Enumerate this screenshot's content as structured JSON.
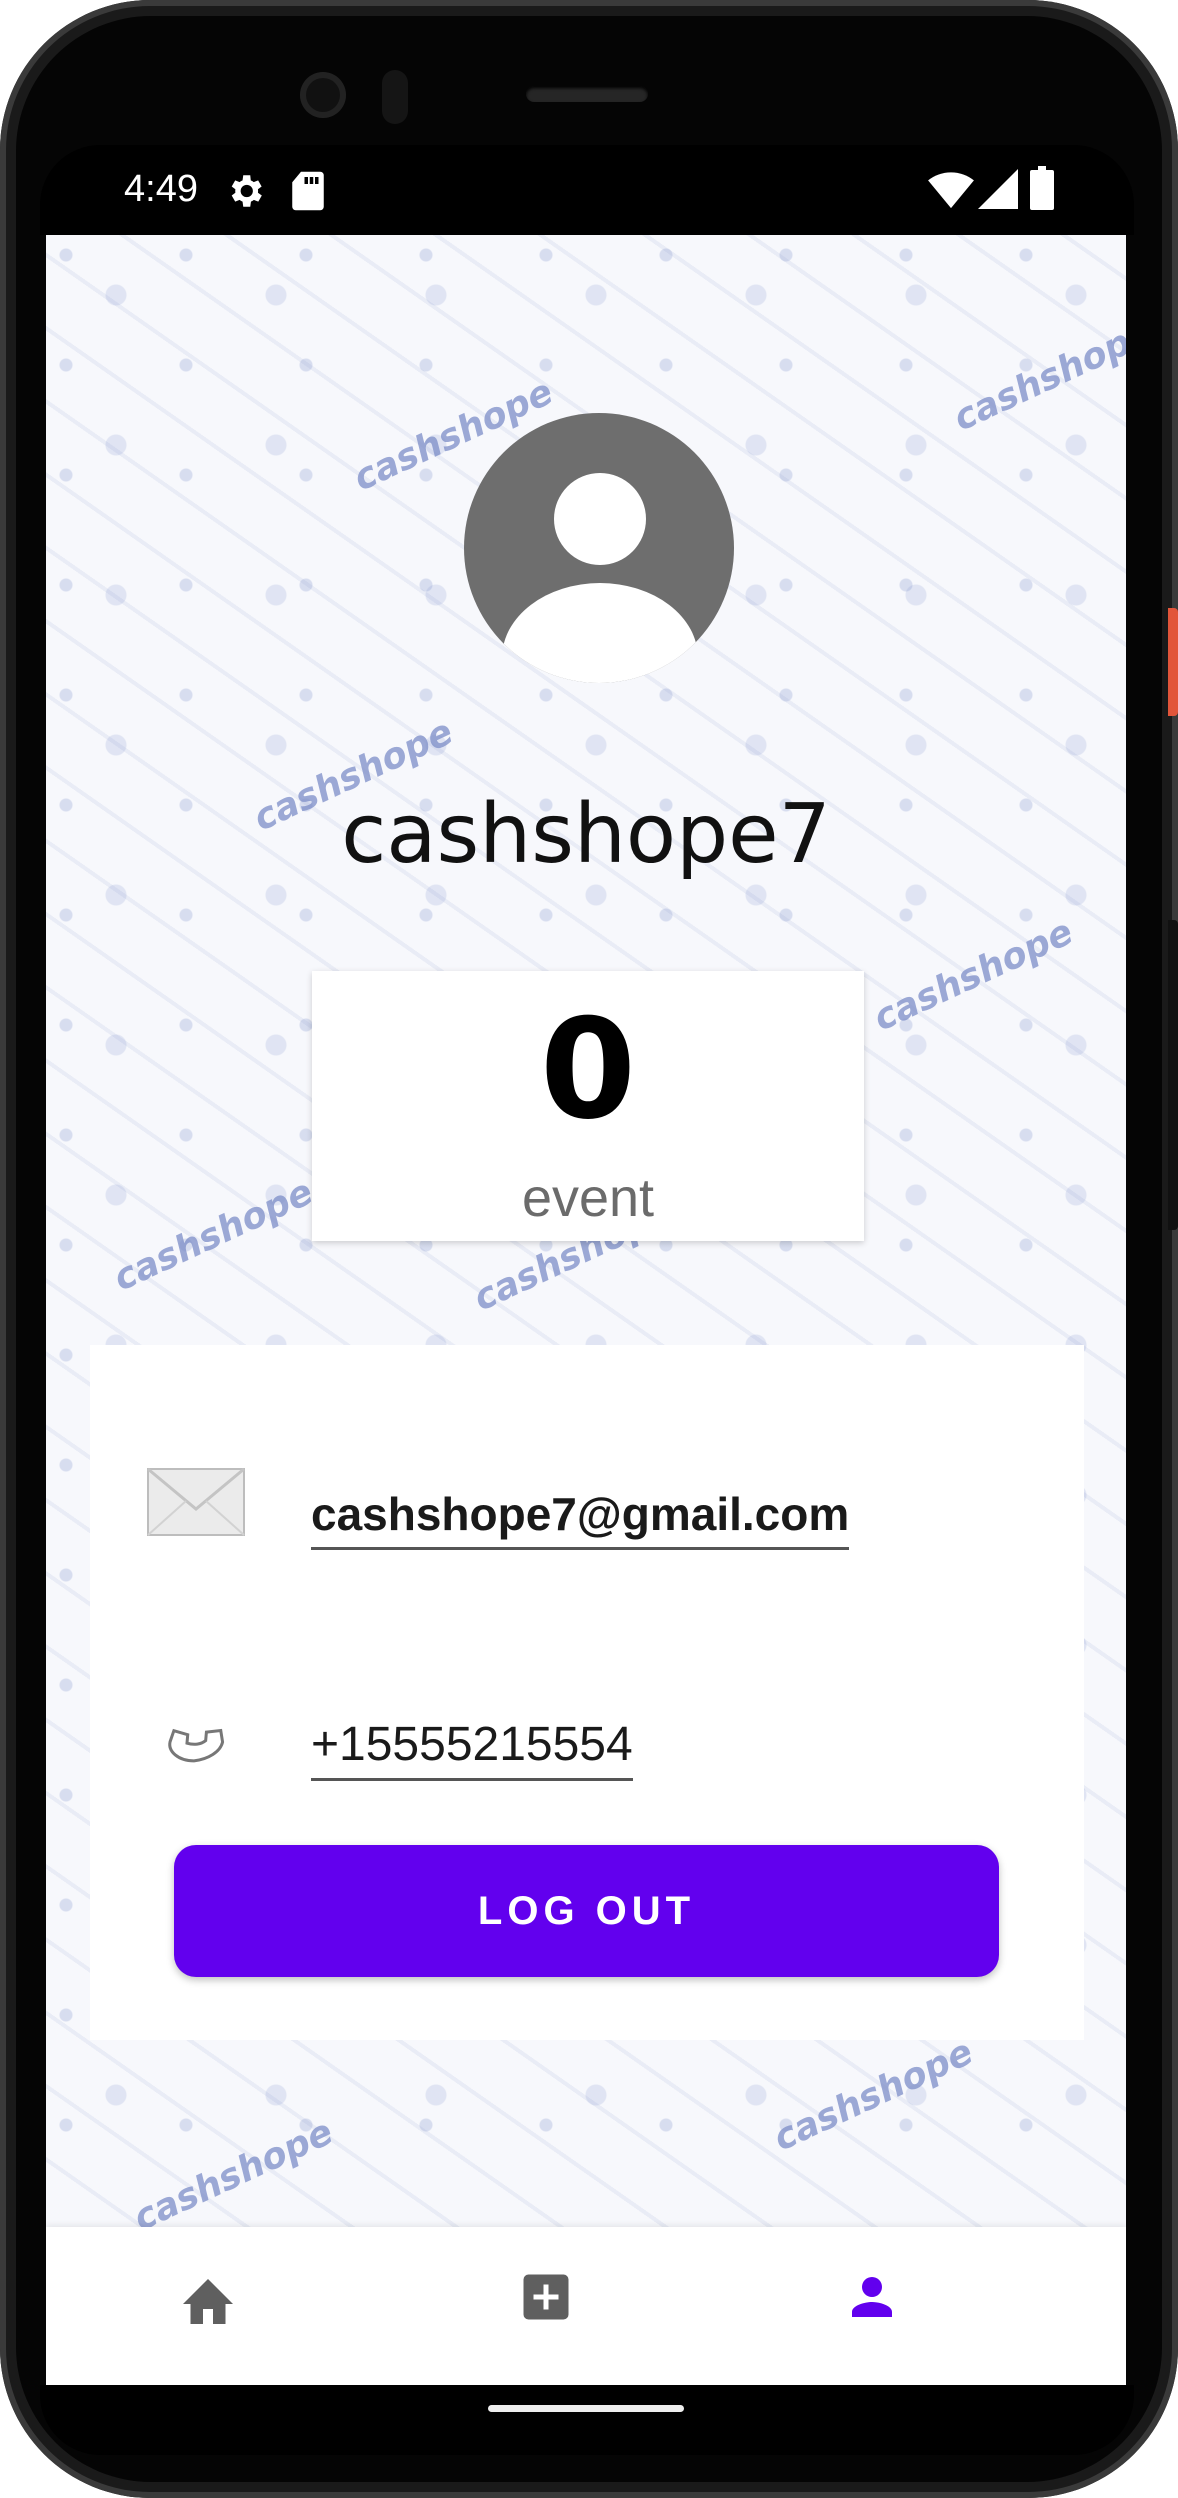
{
  "status_bar": {
    "time": "4:49",
    "icons": [
      "gear-icon",
      "sd-card-icon",
      "wifi-icon",
      "signal-icon",
      "battery-icon"
    ]
  },
  "background": {
    "pattern_text": "cashshope"
  },
  "profile": {
    "username": "cashshope7",
    "event_count": "0",
    "event_label": "event",
    "email": "cashshope7@gmail.com",
    "phone": "+15555215554"
  },
  "actions": {
    "logout_label": "LOG OUT"
  },
  "bottom_nav": {
    "items": [
      {
        "name": "home",
        "icon": "home-icon",
        "active": false
      },
      {
        "name": "add",
        "icon": "add-box-icon",
        "active": false
      },
      {
        "name": "profile",
        "icon": "person-icon",
        "active": true
      }
    ]
  },
  "colors": {
    "accent": "#6200ee",
    "inactive_icon": "#5f5f5f",
    "avatar": "#6e6e6e"
  }
}
